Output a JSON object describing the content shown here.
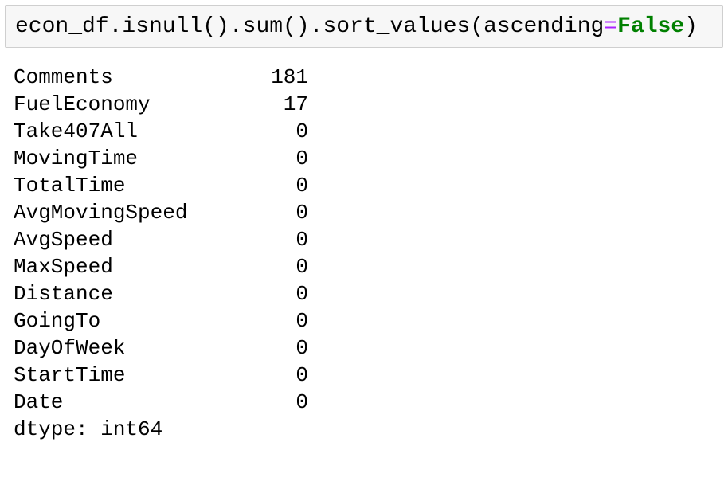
{
  "input": {
    "code_prefix": "econ_df.isnull().sum().sort_values(ascending",
    "code_operator": "=",
    "code_keyword": "False",
    "code_suffix": ")"
  },
  "output": {
    "rows": [
      {
        "label": "Comments",
        "value": "181"
      },
      {
        "label": "FuelEconomy",
        "value": "17"
      },
      {
        "label": "Take407All",
        "value": "0"
      },
      {
        "label": "MovingTime",
        "value": "0"
      },
      {
        "label": "TotalTime",
        "value": "0"
      },
      {
        "label": "AvgMovingSpeed",
        "value": "0"
      },
      {
        "label": "AvgSpeed",
        "value": "0"
      },
      {
        "label": "MaxSpeed",
        "value": "0"
      },
      {
        "label": "Distance",
        "value": "0"
      },
      {
        "label": "GoingTo",
        "value": "0"
      },
      {
        "label": "DayOfWeek",
        "value": "0"
      },
      {
        "label": "StartTime",
        "value": "0"
      },
      {
        "label": "Date",
        "value": "0"
      }
    ],
    "dtype_line": "dtype: int64"
  },
  "colors": {
    "cell_background": "#f7f7f7",
    "cell_border": "#cfcfcf",
    "operator": "#aa22ff",
    "keyword": "#008000"
  }
}
